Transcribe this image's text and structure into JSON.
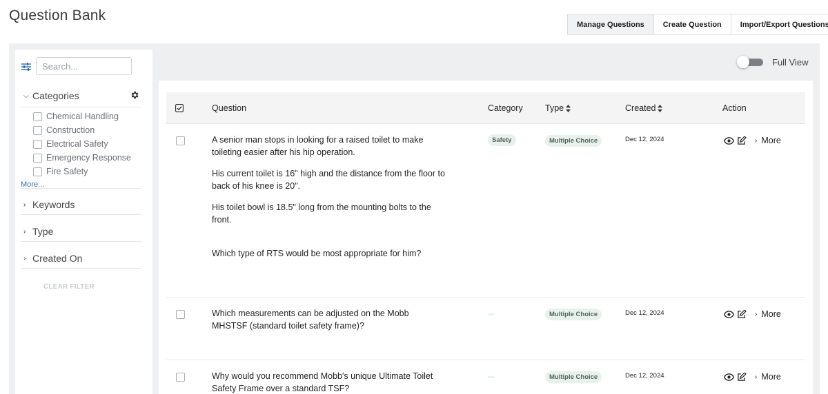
{
  "page": {
    "title": "Question Bank"
  },
  "top_tabs": [
    "Manage Questions",
    "Create Question",
    "Import/Export Questions"
  ],
  "sidebar": {
    "search_placeholder": "Search...",
    "categories_label": "Categories",
    "categories": [
      "Chemical Handling",
      "Construction",
      "Electrical Safety",
      "Emergency Response",
      "Fire Safety"
    ],
    "more_label": "More...",
    "sections": [
      "Keywords",
      "Type",
      "Created On"
    ],
    "clear_filter": "CLEAR FILTER"
  },
  "full_view": {
    "label": "Full View",
    "enabled": false
  },
  "table": {
    "headers": {
      "question": "Question",
      "category": "Category",
      "type": "Type",
      "created": "Created",
      "action": "Action"
    },
    "more_label": "More",
    "rows": [
      {
        "question": [
          "A senior man stops in looking for a raised toilet to make toileting easier after his hip operation.",
          "His current toilet is 16\" high and the distance from the floor to back of his knee is 20\".",
          "His toilet bowl is 18.5\" long from the mounting bolts to the front.",
          "Which type of RTS would be most appropriate for him?"
        ],
        "category": "Safety",
        "type": "Multiple Choice",
        "created": "Dec 12, 2024"
      },
      {
        "question": [
          "Which measurements can be adjusted on the Mobb MHSTSF (standard toilet safety frame)?"
        ],
        "category": "",
        "type": "Multiple Choice",
        "created": "Dec 12, 2024"
      },
      {
        "question": [
          "Why would you recommend Mobb's unique Ultimate Toilet Safety Frame over a standard TSF?"
        ],
        "category": "",
        "type": "Multiple Choice",
        "created": "Dec 12, 2024"
      }
    ]
  },
  "colors": {
    "accent": "#2c6fb7",
    "badge_bg": "#e8f2ec",
    "workspace_bg": "#eeeff1"
  }
}
